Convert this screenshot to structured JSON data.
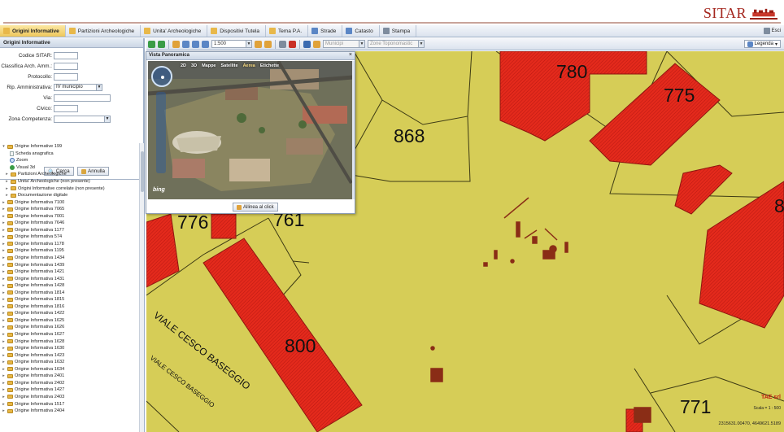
{
  "header": {
    "brand": "SITAR"
  },
  "tabs": [
    {
      "label": "Origini Informative",
      "active": true,
      "icon": "folder-icon"
    },
    {
      "label": "Partizioni Archeologiche",
      "active": false,
      "icon": "folder-icon"
    },
    {
      "label": "Unita' Archeologiche",
      "active": false,
      "icon": "folder-icon"
    },
    {
      "label": "Dispositivi Tutela",
      "active": false,
      "icon": "folder-icon"
    },
    {
      "label": "Tema P.A.",
      "active": false,
      "icon": "folder-icon"
    },
    {
      "label": "Strade",
      "active": false,
      "icon": "map-icon"
    },
    {
      "label": "Catasto",
      "active": false,
      "icon": "map-icon"
    },
    {
      "label": "Stampa",
      "active": false,
      "icon": "print-icon"
    }
  ],
  "exit_label": "Esci",
  "sidebar": {
    "title": "Origini Informative",
    "form": {
      "codice_label": "Codice SITAR:",
      "classifica_label": "Classifica Arch. Amm.:",
      "protocollo_label": "Protocollo:",
      "rip_label": "Rip. Amministrativa:",
      "rip_value": "IV municipio",
      "via_label": "Via:",
      "civico_label": "Civico:",
      "zona_label": "Zona Competenza:"
    },
    "cerca_label": "Cerca",
    "annulla_label": "Annulla",
    "tree_expanded": {
      "label": "Origine Informative 199",
      "children": [
        "Scheda anagrafica",
        "Zoom",
        "Visual 3d",
        "Partizioni Archeologiche",
        "Unita' Archeologiche (non presente)",
        "Origini Informative correlate (non presente)",
        "Documentazione digitale"
      ]
    },
    "tree_items": [
      "Origine Informativa 7100",
      "Origine Informativa 7065",
      "Origine Informativa 7001",
      "Origine Informativa 7646",
      "Origine Informativa 1177",
      "Origine Informativa 574",
      "Origine Informativa 1178",
      "Origine Informativa 1195",
      "Origine Informativa 1434",
      "Origine Informativa 1439",
      "Origine Informativa 1421",
      "Origine Informativa 1431",
      "Origine Informativa 1428",
      "Origine Informativa 1814",
      "Origine Informativa 1815",
      "Origine Informativa 1816",
      "Origine Informativa 1422",
      "Origine Informativa 1625",
      "Origine Informativa 1626",
      "Origine Informativa 1627",
      "Origine Informativa 1628",
      "Origine Informativa 1630",
      "Origine Informativa 1423",
      "Origine Informativa 1632",
      "Origine Informativa 1634",
      "Origine Informativa 2401",
      "Origine Informativa 2402",
      "Origine Informativa 1427",
      "Origine Informativa 2403",
      "Origine Informativa 1517",
      "Origine Informativa 2404"
    ]
  },
  "map_toolbar": {
    "scale_value": "1:500",
    "municipi_placeholder": "Municipi",
    "zone_placeholder": "Zone Toponomastic",
    "legenda_label": "Legenda"
  },
  "panorama": {
    "title": "Vista Panoramica",
    "modes": [
      "2D",
      "3D",
      "Mappe",
      "Satellite",
      "Aerea",
      "Etichette"
    ],
    "active_mode": "Aerea",
    "bing_label": "bing",
    "allinea_label": "Allinea al click"
  },
  "map": {
    "lots": [
      "780",
      "775",
      "868",
      "776",
      "761",
      "800",
      "771",
      "8"
    ],
    "street_main": "VIALE CESCO BASEGGIO",
    "street_small": "VIALE CESCO BASEGGIO",
    "tae_label": "TAE srl",
    "scale_text": "Scala = 1 : 500",
    "coords_text": "2315631.00470, 4649621.5189"
  },
  "colors": {
    "map_background": "#d6cd57",
    "buildings": "#e0231a",
    "archaeology": "#8a2d16",
    "brand": "#a4261e"
  }
}
